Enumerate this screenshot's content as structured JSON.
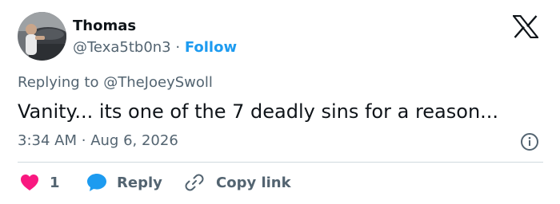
{
  "author": {
    "name": "Thomas",
    "handle": "@Texa5tb0n3",
    "separator": "·",
    "follow_label": "Follow"
  },
  "reply_context": {
    "prefix": "Replying to ",
    "mention": "@TheJoeySwoll"
  },
  "tweet": {
    "text": "Vanity... its one of the 7 deadly sins for a reason...",
    "time": "3:34 AM",
    "separator": "·",
    "date": "Aug 6, 2026"
  },
  "actions": {
    "like_count": "1",
    "reply_label": "Reply",
    "copy_label": "Copy link"
  },
  "icons": {
    "logo": "x-logo-icon",
    "info": "info-icon",
    "like": "heart-icon",
    "reply": "speech-bubble-icon",
    "copy": "link-icon"
  },
  "colors": {
    "accent": "#1d9bf0",
    "like": "#f91880",
    "text": "#0f1419",
    "muted": "#536471",
    "divider": "#cfd9de"
  }
}
